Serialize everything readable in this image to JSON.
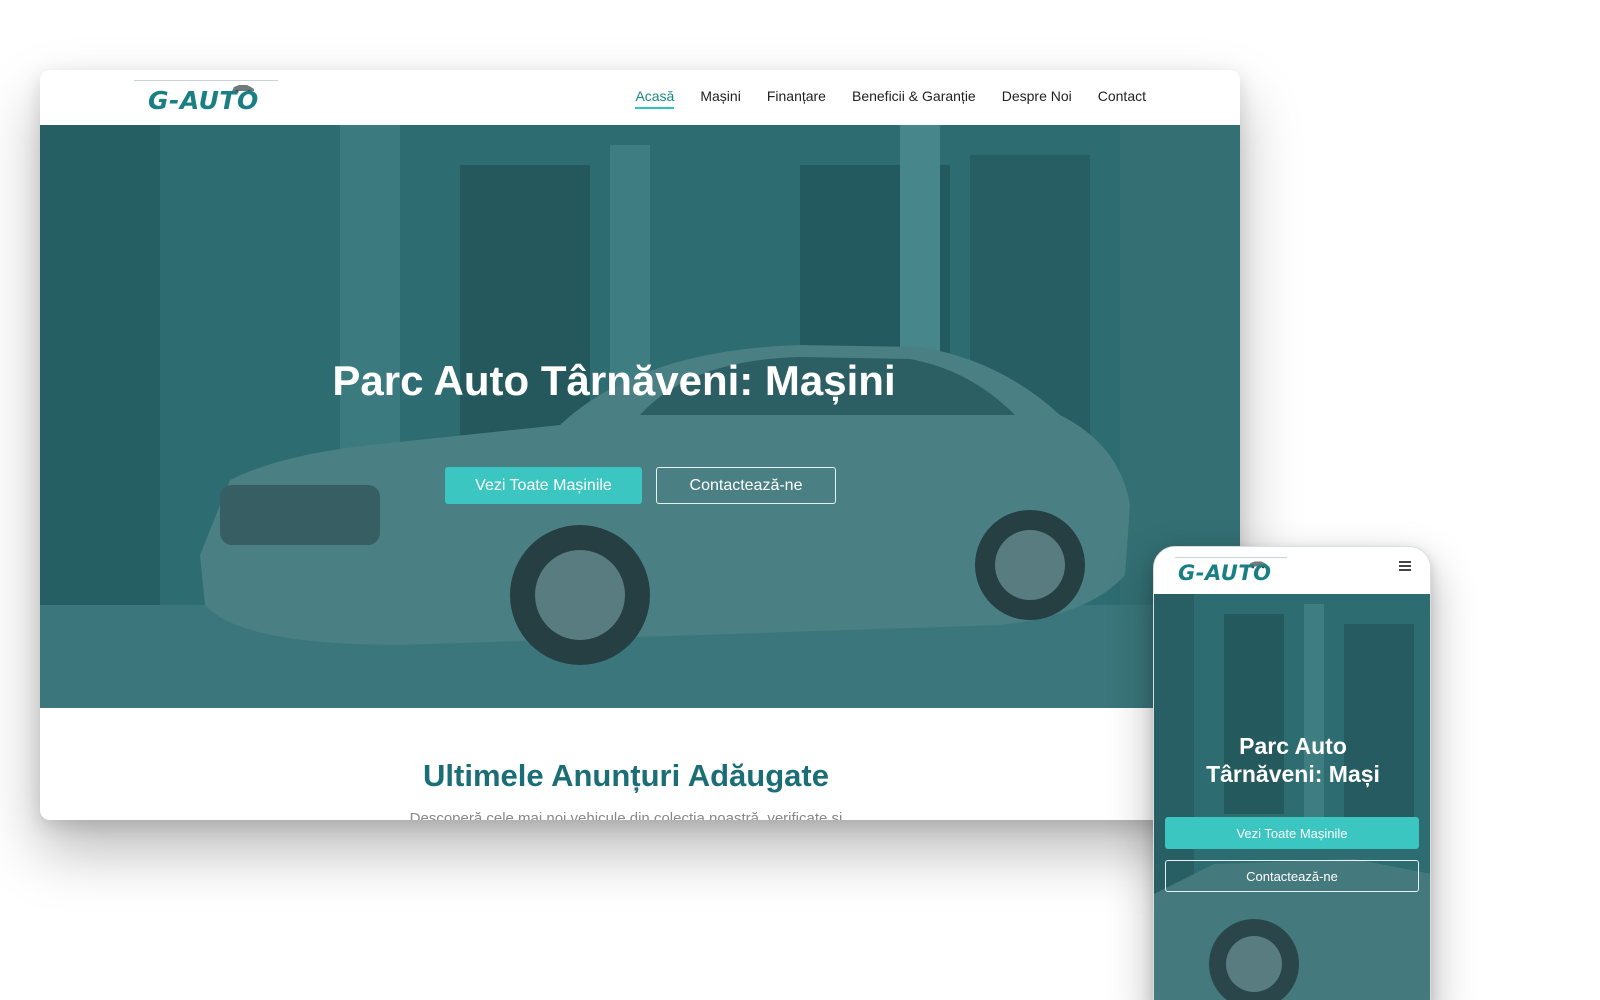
{
  "brand": {
    "logo_text": "G-AUTO",
    "accent": "#3cc6c2",
    "primary_dark": "#1b6e76",
    "hero_overlay": "#2c6b70"
  },
  "nav": {
    "items": [
      {
        "label": "Acasă",
        "active": true
      },
      {
        "label": "Mașini"
      },
      {
        "label": "Finanțare"
      },
      {
        "label": "Beneficii & Garanție"
      },
      {
        "label": "Despre Noi"
      },
      {
        "label": "Contact"
      }
    ]
  },
  "hero": {
    "title": "Parc Auto Târnăveni: Mașini",
    "primary_button": "Vezi Toate Mașinile",
    "secondary_button": "Contactează-ne"
  },
  "latest": {
    "title": "Ultimele Anunțuri Adăugate",
    "subtitle": "Descoperă cele mai noi vehicule din colecția noastră, verificate și"
  },
  "mobile": {
    "menu_icon": "hamburger-icon",
    "hero_title": "Parc Auto\nTârnăveni: Mași",
    "primary_button": "Vezi Toate Mașinile",
    "secondary_button": "Contactează-ne"
  }
}
